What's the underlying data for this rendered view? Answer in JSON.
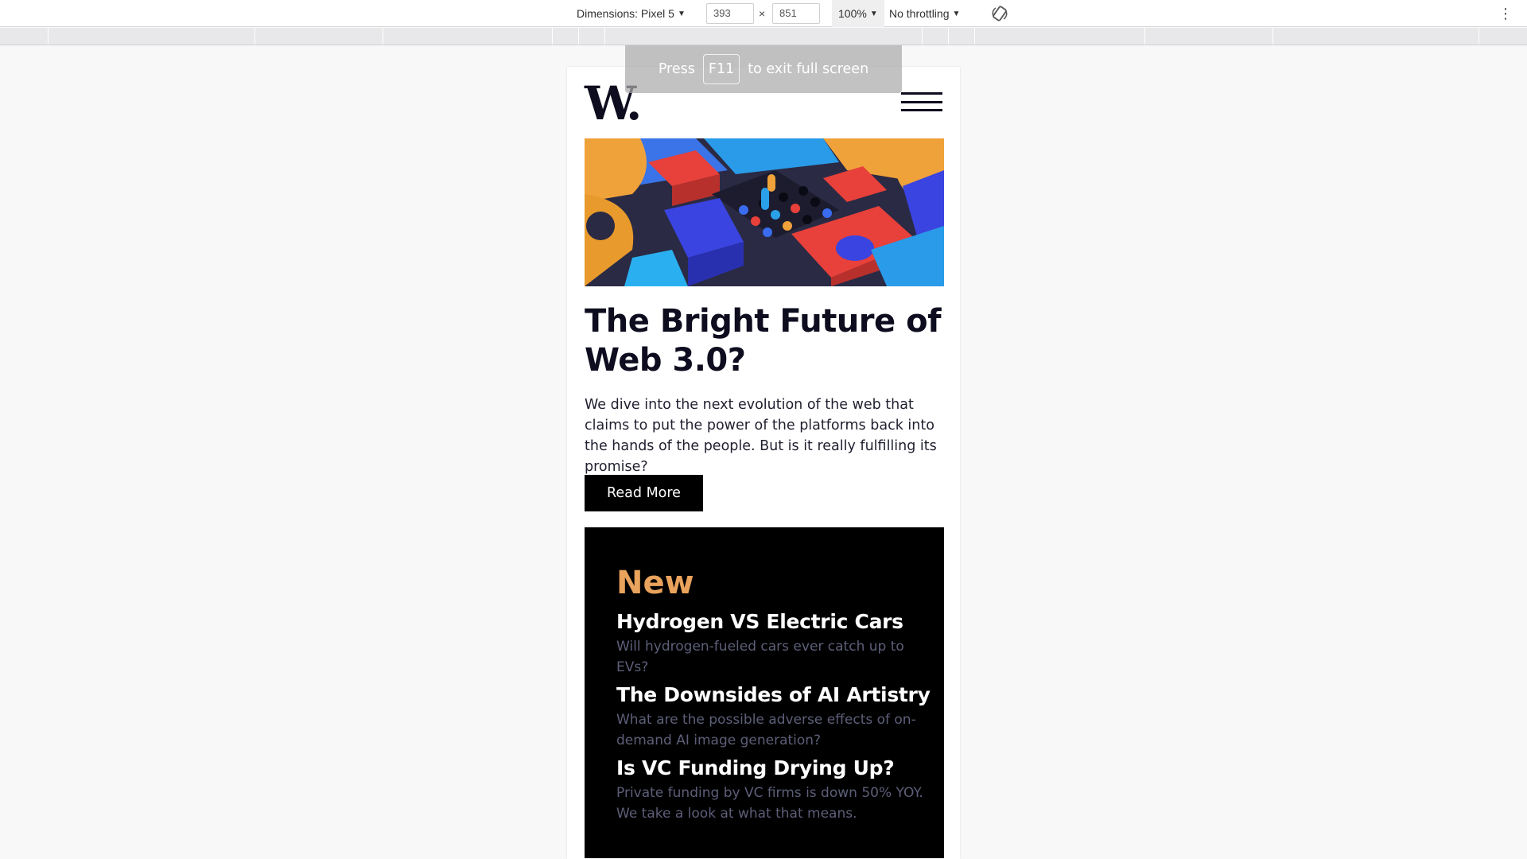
{
  "devtools": {
    "dimensions_label": "Dimensions: Pixel 5",
    "width_value": "393",
    "times": "×",
    "height_value": "851",
    "zoom": "100%",
    "throttling": "No throttling",
    "rotate_icon": "rotate-icon",
    "more_icon": "kebab-icon"
  },
  "toast": {
    "prefix": "Press",
    "key": "F11",
    "suffix": "to exit full screen"
  },
  "site": {
    "logo_letter": "W",
    "logo_dot": ".",
    "menu_icon": "hamburger-icon"
  },
  "article": {
    "title": "The Bright Future of Web 3.0?",
    "description": "We dive into the next evolution of the web that claims to put the power of the platforms back into the hands of the people. But is it really fulfilling its promise?",
    "button": "Read More"
  },
  "new_section": {
    "heading": "New",
    "items": [
      {
        "title": "Hydrogen VS Electric Cars",
        "description": "Will hydrogen-fueled cars ever catch up to EVs?"
      },
      {
        "title": "The Downsides of AI Artistry",
        "description": "What are the possible adverse effects of on-demand AI image generation?"
      },
      {
        "title": "Is VC Funding Drying Up?",
        "description": "Private funding by VC firms is down 50% YOY. We take a look at what that means."
      }
    ]
  },
  "colors": {
    "accent": "#e9a35c",
    "dark": "#0d0d1f",
    "muted": "#5d5f79"
  }
}
